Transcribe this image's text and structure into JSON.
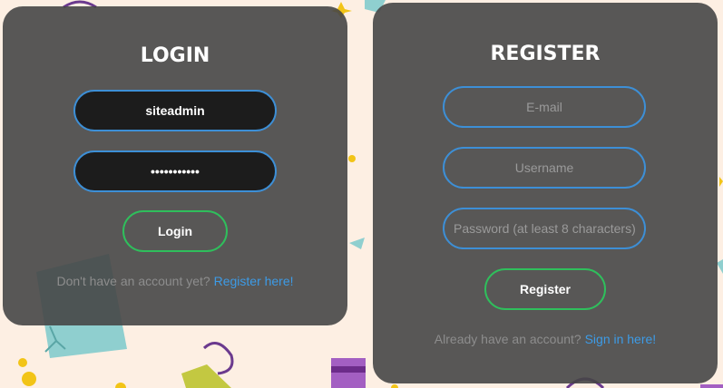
{
  "login": {
    "title": "LOGIN",
    "username_value": "siteadmin",
    "password_value": "•••••••••••",
    "button_label": "Login",
    "footer_text": "Don't have an account yet?",
    "footer_link": "Register here!"
  },
  "register": {
    "title": "REGISTER",
    "email_placeholder": "E-mail",
    "username_placeholder": "Username",
    "password_placeholder": "Password (at least 8 characters)",
    "button_label": "Register",
    "footer_text": "Already have an account?",
    "footer_link": "Sign in here!"
  },
  "colors": {
    "background": "#fdefe3",
    "panel": "#464646",
    "field_border": "#3d8fd6",
    "button_border": "#2fbf5c",
    "link": "#3d9be6"
  }
}
